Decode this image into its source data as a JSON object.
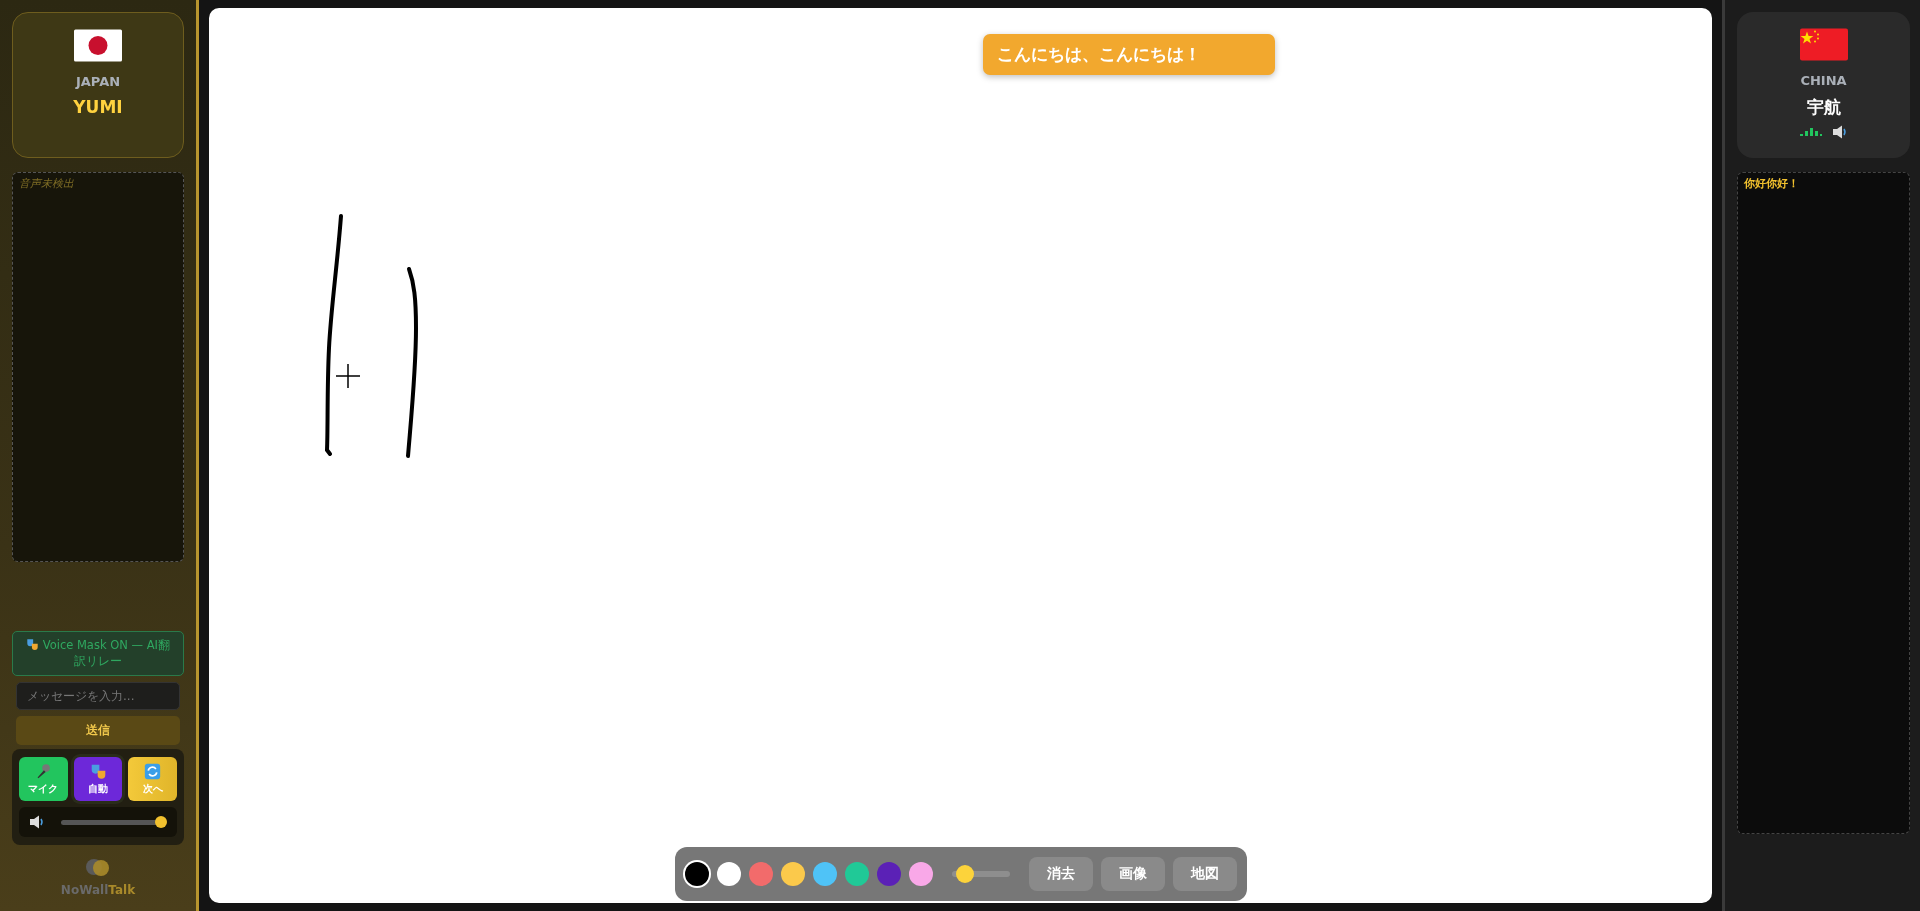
{
  "left_panel": {
    "flag": {
      "kind": "japan"
    },
    "country": "JAPAN",
    "name": "YUMI",
    "transcript": "音声未検出",
    "voice_mask": "Voice Mask ON — AI翻訳リレー",
    "message_input": {
      "placeholder": "メッセージを入力..."
    },
    "send_button": "送信",
    "controls": [
      {
        "kind": "mic",
        "label": "マイク"
      },
      {
        "kind": "auto",
        "label": "自動"
      },
      {
        "kind": "next",
        "label": "次へ"
      }
    ],
    "volume": {
      "level": 1.0
    },
    "brand": "NoWallTalk"
  },
  "canvas": {
    "toast": "こんにちは、こんにちは！",
    "toolbar": {
      "colors": [
        {
          "color": "#000000",
          "selected": true
        },
        {
          "color": "#ffffff",
          "selected": false
        },
        {
          "color": "#f26b6b",
          "selected": false
        },
        {
          "color": "#fbc94b",
          "selected": false
        },
        {
          "color": "#4fc3f7",
          "selected": false
        },
        {
          "color": "#20c997",
          "selected": false
        },
        {
          "color": "#5b21b6",
          "selected": false
        },
        {
          "color": "#f9a8e8",
          "selected": false
        }
      ],
      "brush_size": {
        "level": 0.22
      },
      "buttons": [
        "消去",
        "画像",
        "地図"
      ]
    }
  },
  "right_panel": {
    "flag": {
      "kind": "china"
    },
    "country": "CHINA",
    "name": "宇航",
    "transcript": "你好你好！"
  }
}
